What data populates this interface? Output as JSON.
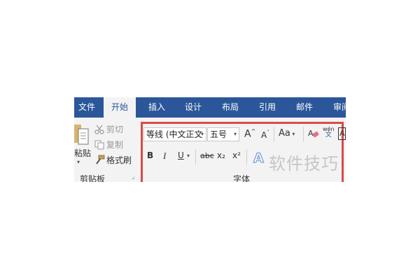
{
  "tabs": [
    {
      "label": "文件",
      "active": false
    },
    {
      "label": "开始",
      "active": true
    },
    {
      "label": "插入",
      "active": false
    },
    {
      "label": "设计",
      "active": false
    },
    {
      "label": "布局",
      "active": false
    },
    {
      "label": "引用",
      "active": false
    },
    {
      "label": "邮件",
      "active": false
    },
    {
      "label": "审阅",
      "active": false
    }
  ],
  "clipboard": {
    "paste_label": "粘贴",
    "cut_label": "剪切",
    "copy_label": "复制",
    "format_painter_label": "格式刷",
    "group_label": "剪贴板"
  },
  "font": {
    "font_name": "等线 (中文正文",
    "font_size": "五号",
    "grow_label": "A",
    "shrink_label": "A",
    "case_label": "Aa",
    "bold": "B",
    "italic": "I",
    "underline": "U",
    "strikethrough": "abc",
    "subscript": "x₂",
    "superscript": "x²",
    "phonetic_top": "wén",
    "phonetic_bottom": "文",
    "group_label": "字体"
  },
  "watermark": {
    "text": "软件技巧"
  },
  "colors": {
    "tab_bar": "#2b579a",
    "highlight_box": "#d94b4b",
    "ribbon_bg": "#f3f3f3"
  }
}
